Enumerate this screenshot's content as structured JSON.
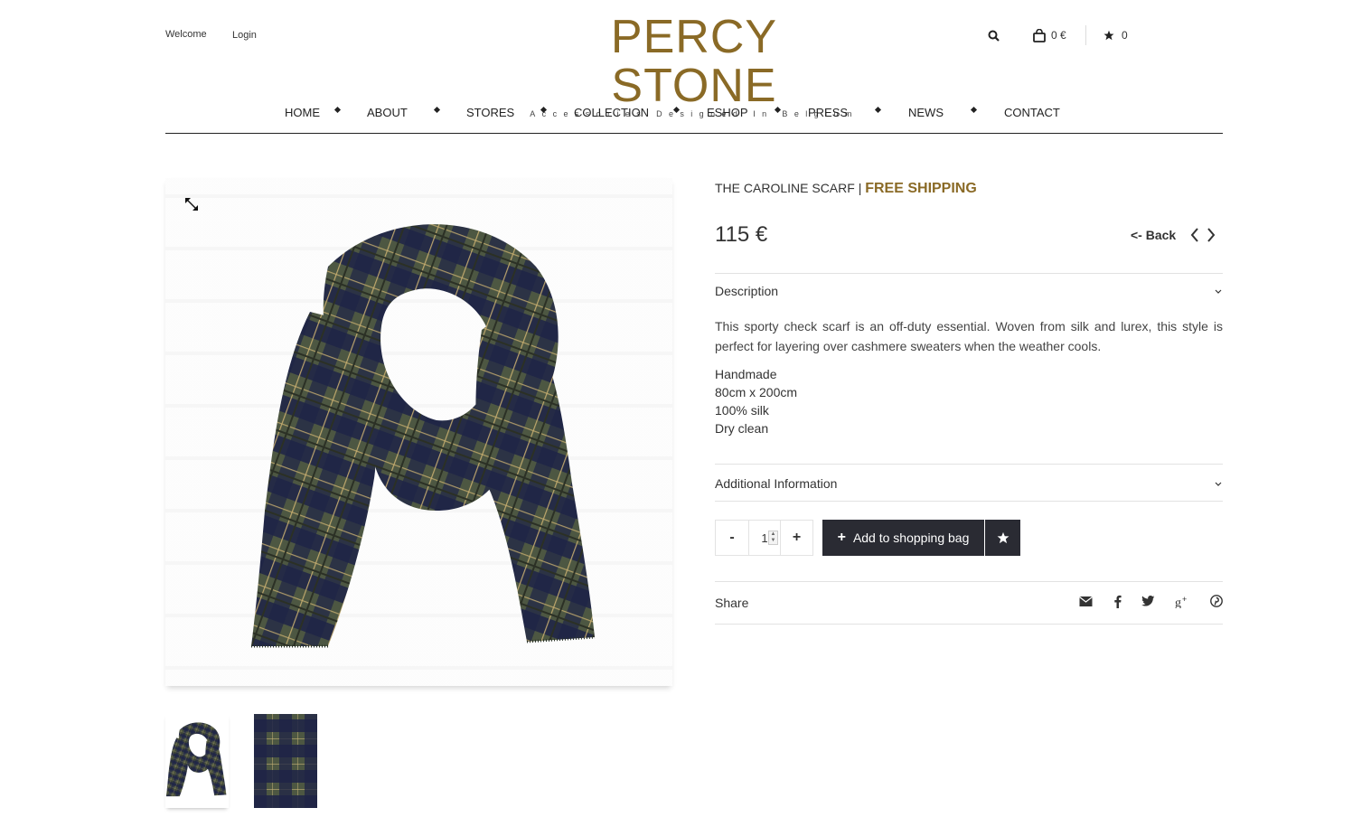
{
  "header": {
    "welcome": "Welcome",
    "login": "Login",
    "logo_title": "PERCY STONE",
    "logo_subtitle": "Accessories Designed In Belgium",
    "cart_amount": "0 €",
    "wishlist_count": "0",
    "icons": [
      "search-icon",
      "shopping-bag-icon",
      "star-icon"
    ]
  },
  "nav": {
    "items": [
      "HOME",
      "ABOUT",
      "STORES",
      "COLLECTION",
      "ESHOP",
      "PRESS",
      "NEWS",
      "CONTACT"
    ]
  },
  "product": {
    "title": "THE CAROLINE SCARF |",
    "shipping": "FREE SHIPPING",
    "price": "115 €",
    "back_label": "<- Back",
    "description_heading": "Description",
    "description_text": "This sporty check scarf is an off-duty essential. Woven from silk and lurex, this style is perfect for layering over cashmere sweaters when the weather cools.",
    "specs": [
      "Handmade",
      "80cm x 200cm",
      "100% silk",
      "Dry clean"
    ],
    "additional_heading": "Additional Information",
    "quantity": "1",
    "minus_label": "-",
    "plus_label": "+",
    "add_to_bag_label": "Add to shopping bag",
    "share_label": "Share",
    "share_icons": [
      "envelope-icon",
      "facebook-icon",
      "twitter-icon",
      "google-plus-icon",
      "pinterest-icon"
    ]
  },
  "colors": {
    "brand_gold": "#8a6a26",
    "button_dark": "#2a2b33",
    "scarf_green": "#4d5742",
    "scarf_navy": "#1e2346"
  }
}
